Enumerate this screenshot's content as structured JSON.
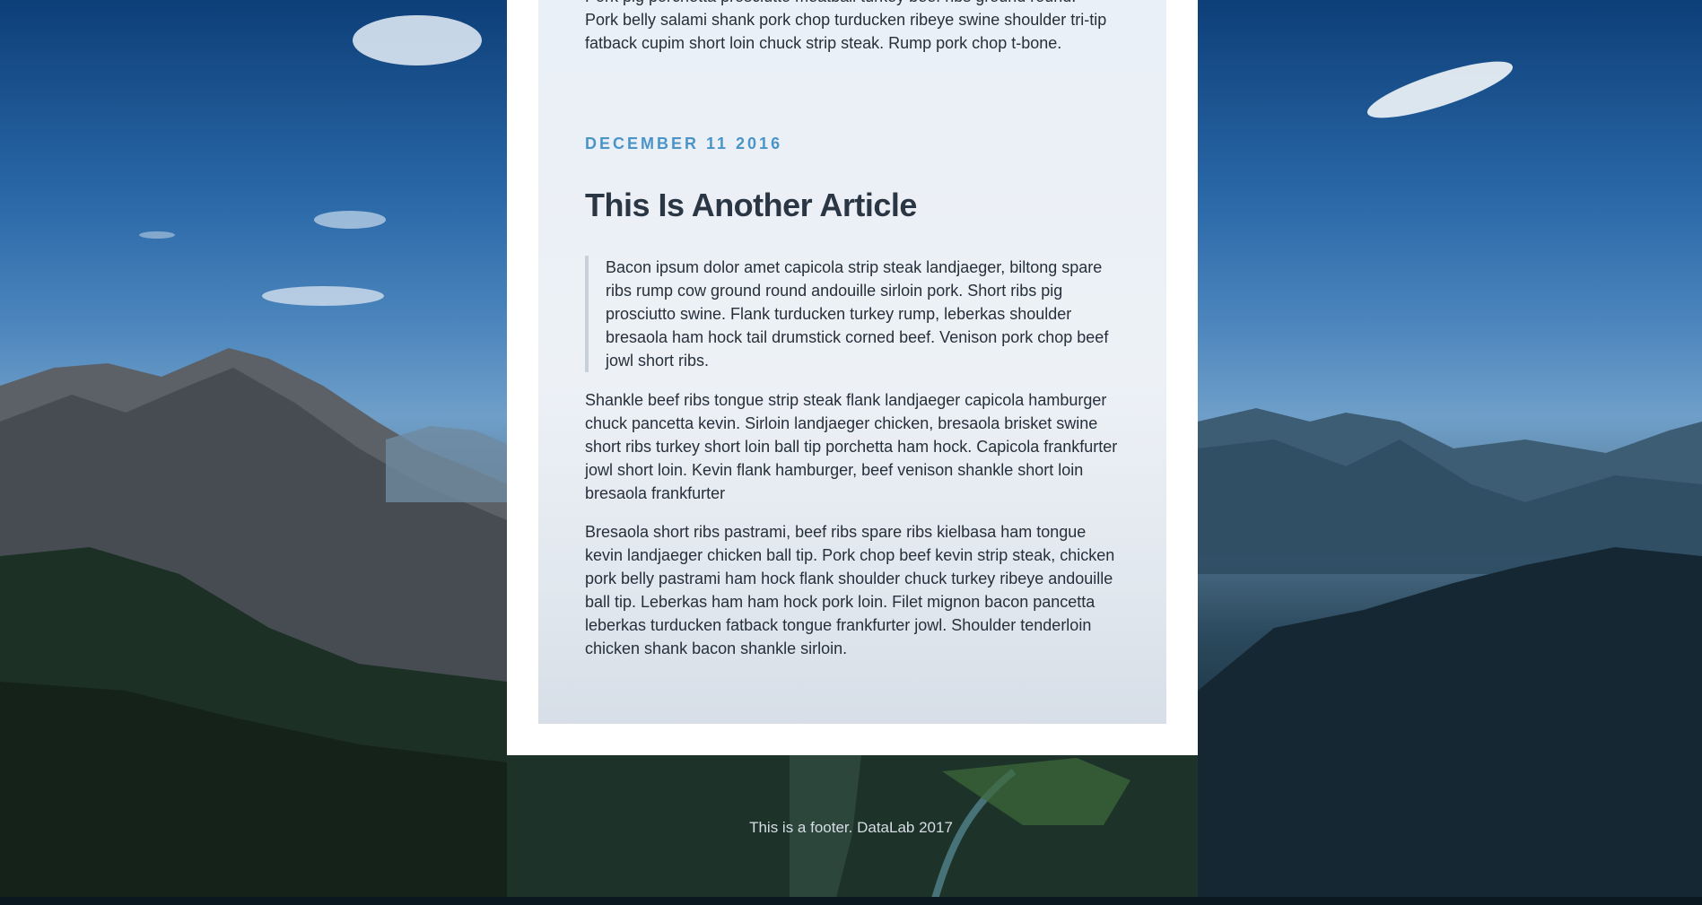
{
  "page": {
    "theme_colors": {
      "card_background": "#ffffff",
      "date_accent": "#4a94c8",
      "title_color": "#2b3644",
      "body_text": "#26303b",
      "footer_text": "#d6dde4"
    }
  },
  "article_prev": {
    "partial_line_1": "Pork pig porchetta prosciutto meatball turkey beef ribs ground round.",
    "body": "Pork belly salami shank pork chop turducken ribeye swine shoulder tri-tip fatback cupim short loin chuck strip steak. Rump pork chop t-bone."
  },
  "article": {
    "date": "DECEMBER 11 2016",
    "title": "This Is Another Article",
    "blockquote": "Bacon ipsum dolor amet capicola strip steak landjaeger, biltong spare ribs rump cow ground round andouille sirloin pork. Short ribs pig prosciutto swine. Flank turducken turkey rump, leberkas shoulder bresaola ham hock tail drumstick corned beef. Venison pork chop beef jowl short ribs.",
    "paragraph_1": "Shankle beef ribs tongue strip steak flank landjaeger capicola hamburger chuck pancetta kevin. Sirloin landjaeger chicken, bresaola brisket swine short ribs turkey short loin ball tip porchetta ham hock. Capicola frankfurter jowl short loin. Kevin flank hamburger, beef venison shankle short loin bresaola frankfurter",
    "paragraph_2": "Bresaola short ribs pastrami, beef ribs spare ribs kielbasa ham tongue kevin landjaeger chicken ball tip. Pork chop beef kevin strip steak, chicken pork belly pastrami ham hock flank shoulder chuck turkey ribeye andouille ball tip. Leberkas ham ham hock pork loin. Filet mignon bacon pancetta leberkas turducken fatback tongue frankfurter jowl. Shoulder tenderloin chicken shank bacon shankle sirloin."
  },
  "footer": {
    "text": "This is a footer. DataLab 2017"
  }
}
